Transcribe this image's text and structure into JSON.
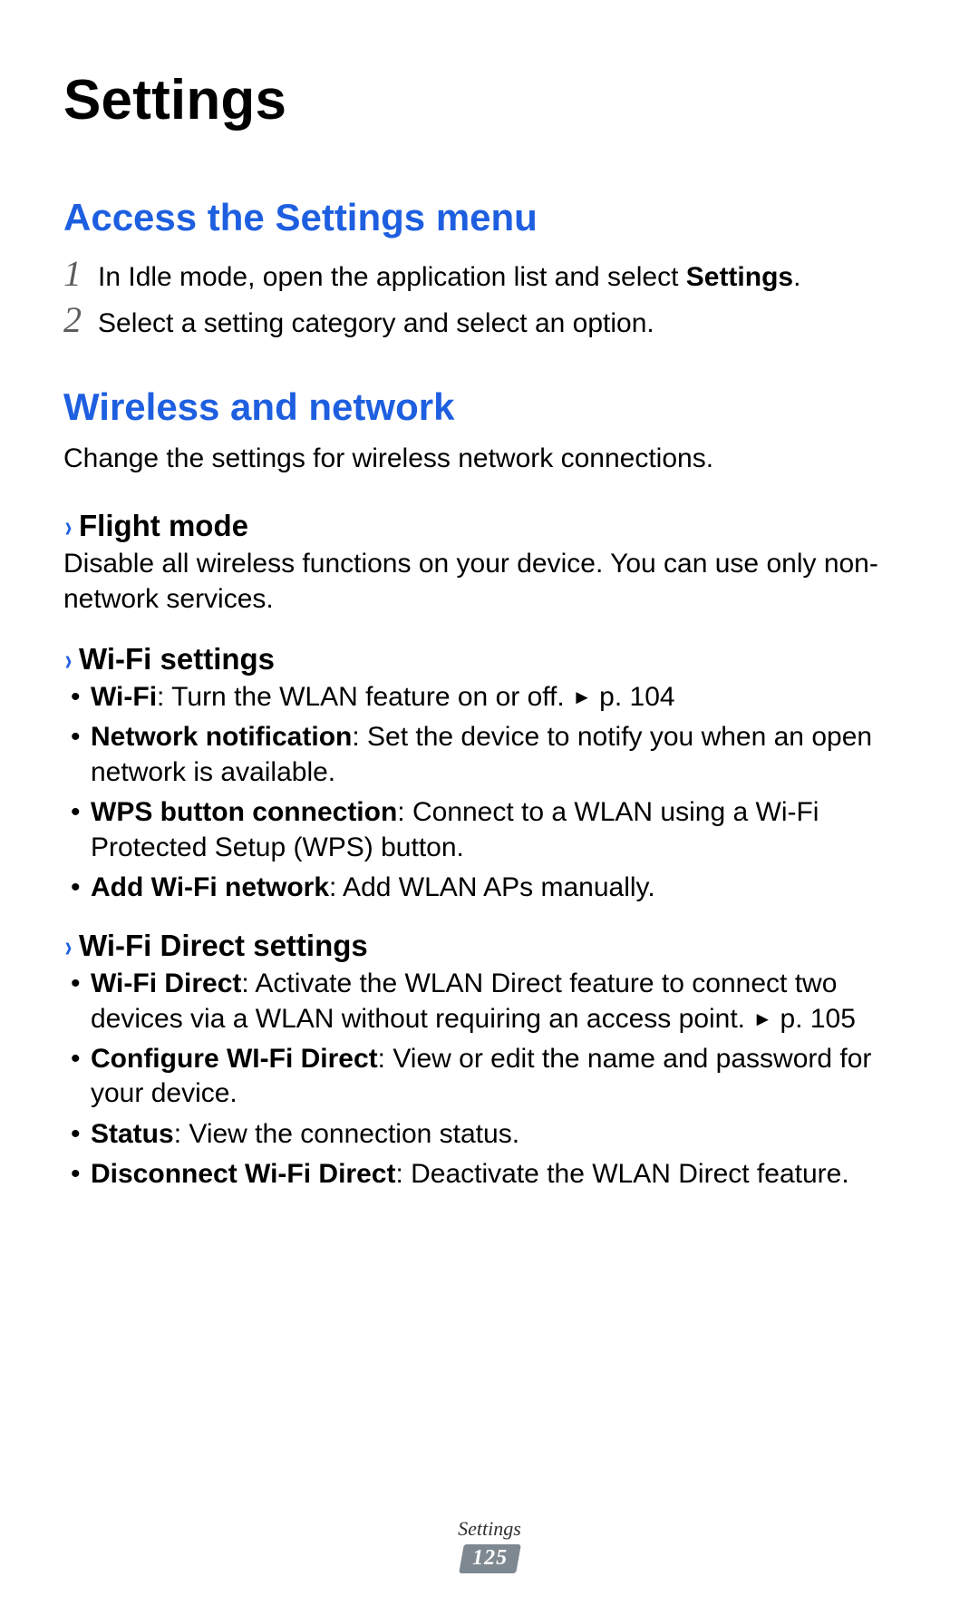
{
  "title": "Settings",
  "section_access": {
    "heading": "Access the Settings menu",
    "steps": [
      {
        "num": "1",
        "pre": "In Idle mode, open the application list and select ",
        "bold": "Settings",
        "post": "."
      },
      {
        "num": "2",
        "pre": "Select a setting category and select an option.",
        "bold": "",
        "post": ""
      }
    ]
  },
  "section_wireless": {
    "heading": "Wireless and network",
    "intro": "Change the settings for wireless network connections.",
    "subs": {
      "flight": {
        "title": "Flight mode",
        "body": "Disable all wireless functions on your device. You can use only non-network services."
      },
      "wifi": {
        "title": "Wi-Fi settings",
        "items": [
          {
            "term": "Wi-Fi",
            "desc_pre": ": Turn the WLAN feature on or off. ",
            "arrow": "►",
            "desc_post": " p. 104"
          },
          {
            "term": "Network notification",
            "desc_pre": ": Set the device to notify you when an open network is available.",
            "arrow": "",
            "desc_post": ""
          },
          {
            "term": "WPS button connection",
            "desc_pre": ": Connect to a WLAN using a Wi-Fi Protected Setup (WPS) button.",
            "arrow": "",
            "desc_post": ""
          },
          {
            "term": "Add Wi-Fi network",
            "desc_pre": ": Add WLAN APs manually.",
            "arrow": "",
            "desc_post": ""
          }
        ]
      },
      "wifidirect": {
        "title": "Wi-Fi Direct settings",
        "items": [
          {
            "term": "Wi-Fi Direct",
            "desc_pre": ": Activate the WLAN Direct feature to connect two devices via a WLAN without requiring an access point. ",
            "arrow": "►",
            "desc_post": " p. 105"
          },
          {
            "term": "Configure WI-Fi Direct",
            "desc_pre": ": View or edit the name and password for your device.",
            "arrow": "",
            "desc_post": ""
          },
          {
            "term": "Status",
            "desc_pre": ": View the connection status.",
            "arrow": "",
            "desc_post": ""
          },
          {
            "term": "Disconnect Wi-Fi Direct",
            "desc_pre": ": Deactivate the WLAN Direct feature.",
            "arrow": "",
            "desc_post": ""
          }
        ]
      }
    }
  },
  "footer": {
    "label": "Settings",
    "page": "125"
  },
  "chevron_glyph": "›"
}
